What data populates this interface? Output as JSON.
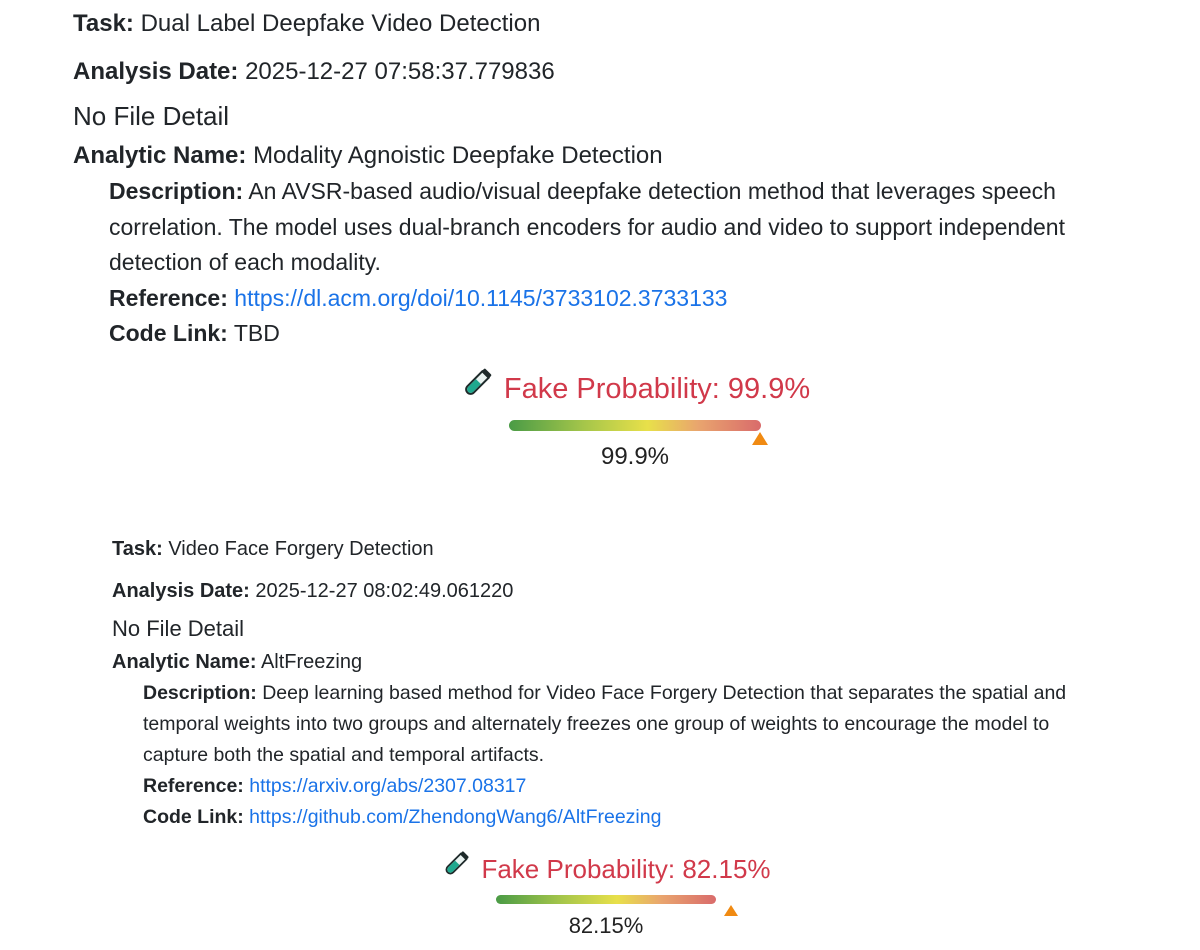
{
  "results": [
    {
      "task_label": "Task:",
      "task": "Dual Label Deepfake Video Detection",
      "date_label": "Analysis Date:",
      "date": "2025-12-27 07:58:37.779836",
      "file_detail": "No File Detail",
      "analytic_label": "Analytic Name:",
      "analytic_name": "Modality Agnoistic Deepfake Detection",
      "description_label": "Description:",
      "description": "An AVSR-based audio/visual deepfake detection method that leverages speech correlation. The model uses dual-branch encoders for audio and video to support independent detection of each modality.",
      "reference_label": "Reference:",
      "reference": "https://dl.acm.org/doi/10.1145/3733102.3733133",
      "code_label": "Code Link:",
      "code_link": "TBD",
      "probability_title": "Fake Probability: 99.9%",
      "probability_value": "99.9%",
      "probability_fraction": 0.999
    },
    {
      "task_label": "Task:",
      "task": "Video Face Forgery Detection",
      "date_label": "Analysis Date:",
      "date": "2025-12-27 08:02:49.061220",
      "file_detail": "No File Detail",
      "analytic_label": "Analytic Name:",
      "analytic_name": "AltFreezing",
      "description_label": "Description:",
      "description": "Deep learning based method for Video Face Forgery Detection that separates the spatial and temporal weights into two groups and alternately freezes one group of weights to encourage the model to capture both the spatial and temporal artifacts.",
      "reference_label": "Reference:",
      "reference": "https://arxiv.org/abs/2307.08317",
      "code_label": "Code Link:",
      "code_link": "https://github.com/ZhendongWang6/AltFreezing",
      "probability_title": "Fake Probability: 82.15%",
      "probability_value": "82.15%",
      "probability_fraction": 0.8215
    }
  ],
  "colors": {
    "probability_text": "#d1394a",
    "link": "#1a73e8",
    "marker": "#f08a12"
  },
  "icons": {
    "probability": "test-tube-icon"
  }
}
